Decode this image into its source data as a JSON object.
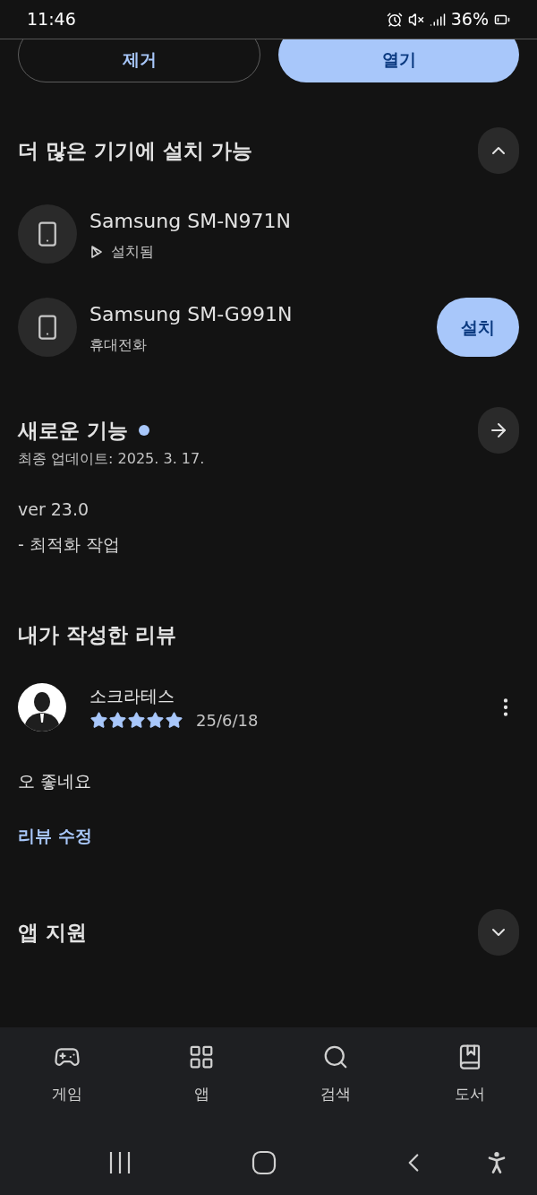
{
  "status_bar": {
    "time": "11:46",
    "battery": "36%"
  },
  "top_buttons": [
    {
      "label": "제거",
      "kind": "outline"
    },
    {
      "label": "열기",
      "kind": "filled"
    }
  ],
  "devices_section": {
    "title": "더 많은 기기에 설치 가능",
    "expanded": true,
    "devices": [
      {
        "name": "Samsung SM-N971N",
        "status": "설치됨",
        "installed": true
      },
      {
        "name": "Samsung SM-G991N",
        "status": "휴대전화",
        "installed": false,
        "action": "설치"
      }
    ]
  },
  "whats_new": {
    "title": "새로운 기능",
    "new_dot": true,
    "updated": "최종 업데이트: 2025. 3. 17.",
    "notes": [
      "ver 23.0",
      "- 최적화 작업"
    ]
  },
  "my_review": {
    "title": "내가 작성한 리뷰",
    "author": "소크라테스",
    "stars": 5,
    "date": "25/6/18",
    "text": "오 좋네요",
    "edit_link": "리뷰 수정"
  },
  "app_support": {
    "title": "앱 지원",
    "expanded": false
  },
  "bottom_nav": [
    {
      "label": "게임",
      "kind": "games",
      "selected": false
    },
    {
      "label": "앱",
      "kind": "apps",
      "selected": false
    },
    {
      "label": "검색",
      "kind": "search",
      "selected": false
    },
    {
      "label": "도서",
      "kind": "books",
      "selected": false
    }
  ]
}
